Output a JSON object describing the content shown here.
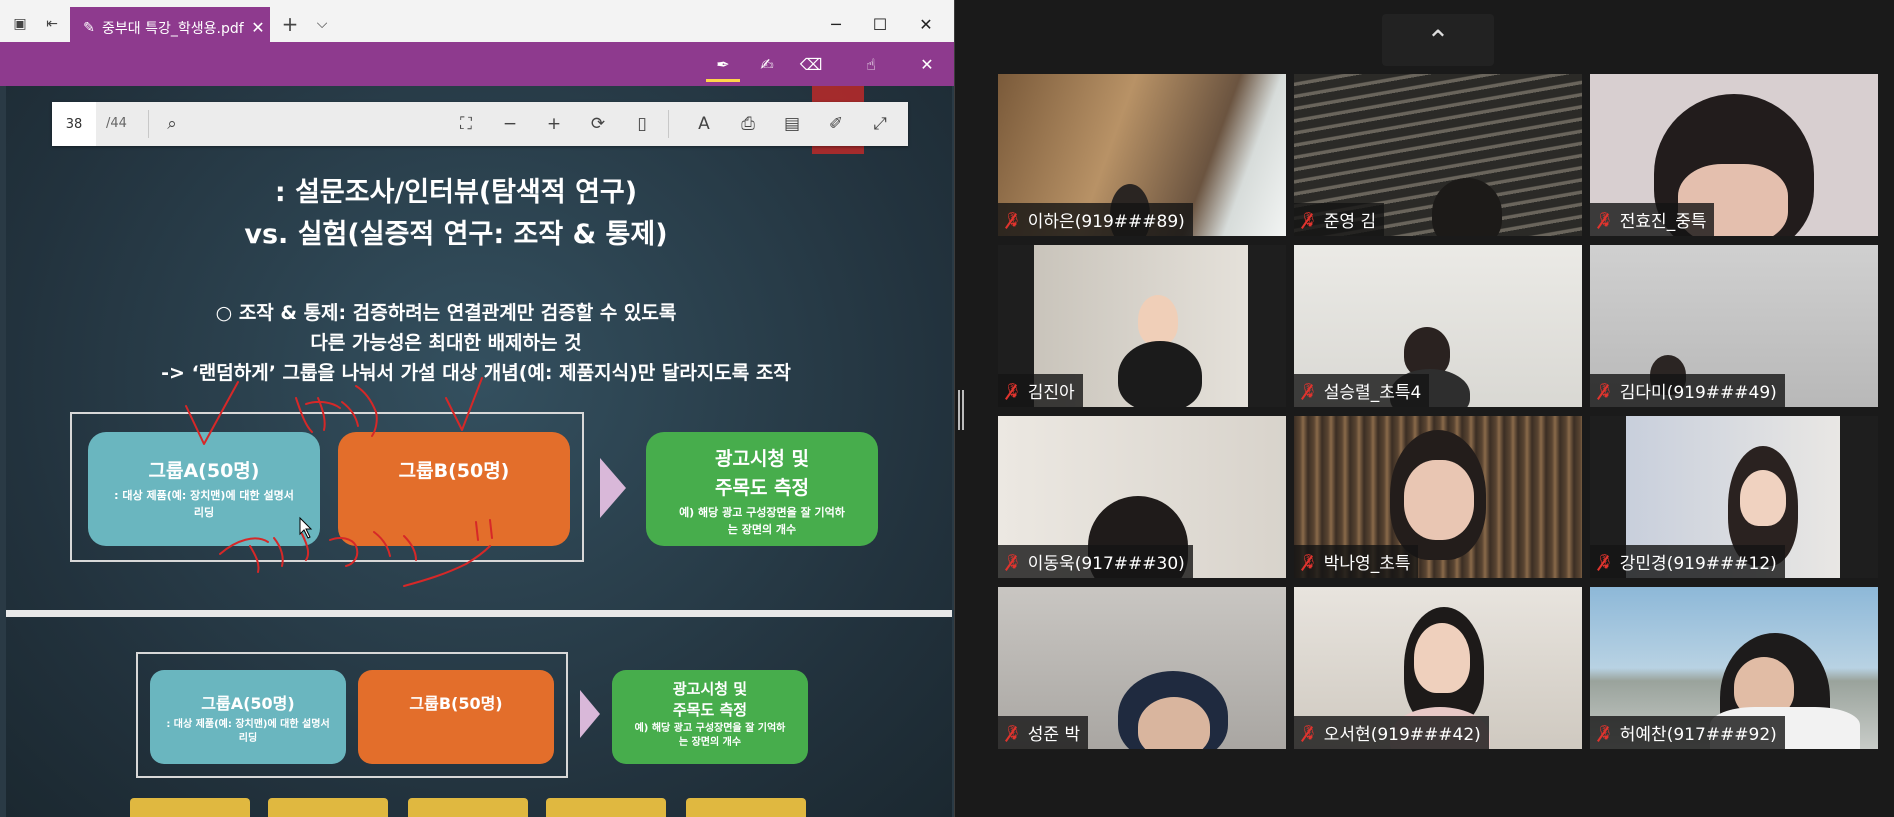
{
  "pdf_viewer": {
    "tab_title": "중부대 특강_학생용.pdf",
    "tab_close": "✕",
    "new_tab": "+",
    "tab_list": "⌵",
    "minimize": "─",
    "maximize": "☐",
    "close": "✕",
    "page_number": "38",
    "page_total": "/44",
    "accent_color": "#8e3a8e"
  },
  "slide": {
    "heading_line1": ": 설문조사/인터뷰(탐색적 연구)",
    "heading_line2": "vs. 실험(실증적 연구: 조작 & 통제)",
    "bullet_line1": "○ 조작 & 통제: 검증하려는 연결관계만 검증할 수 있도록",
    "bullet_line2": "다른  가능성은 최대한 배제하는 것",
    "bullet_line3": "-> ‘랜덤하게’ 그룹을 나눠서 가설 대상 개념(예: 제품지식)만 달라지도록 조작",
    "group_a_title": "그룹A(50명)",
    "group_a_desc": ": 대상 제품(예: 장치맨)에 대한 설명서 리딩",
    "group_b_title": "그룹B(50명)",
    "ad_title_line1": "광고시청 및",
    "ad_title_line2": "주목도 측정",
    "ad_desc": "예) 해당 광고 구성장면을 잘 기억하는 장면의 개수"
  },
  "participants": [
    {
      "name": "이하은(919###89)"
    },
    {
      "name": "준영 김"
    },
    {
      "name": "전효진_중특"
    },
    {
      "name": "김진아"
    },
    {
      "name": "설승렬_초특4"
    },
    {
      "name": "김다미(919###49)"
    },
    {
      "name": "이동욱(917###30)"
    },
    {
      "name": "박나영_초특"
    },
    {
      "name": "강민경(919###12)"
    },
    {
      "name": "성준 박"
    },
    {
      "name": "오서현(919###42)"
    },
    {
      "name": "허예찬(917###92)"
    }
  ],
  "gallery": {
    "collapse_icon": "⌃",
    "muted_color": "#e0342e"
  }
}
